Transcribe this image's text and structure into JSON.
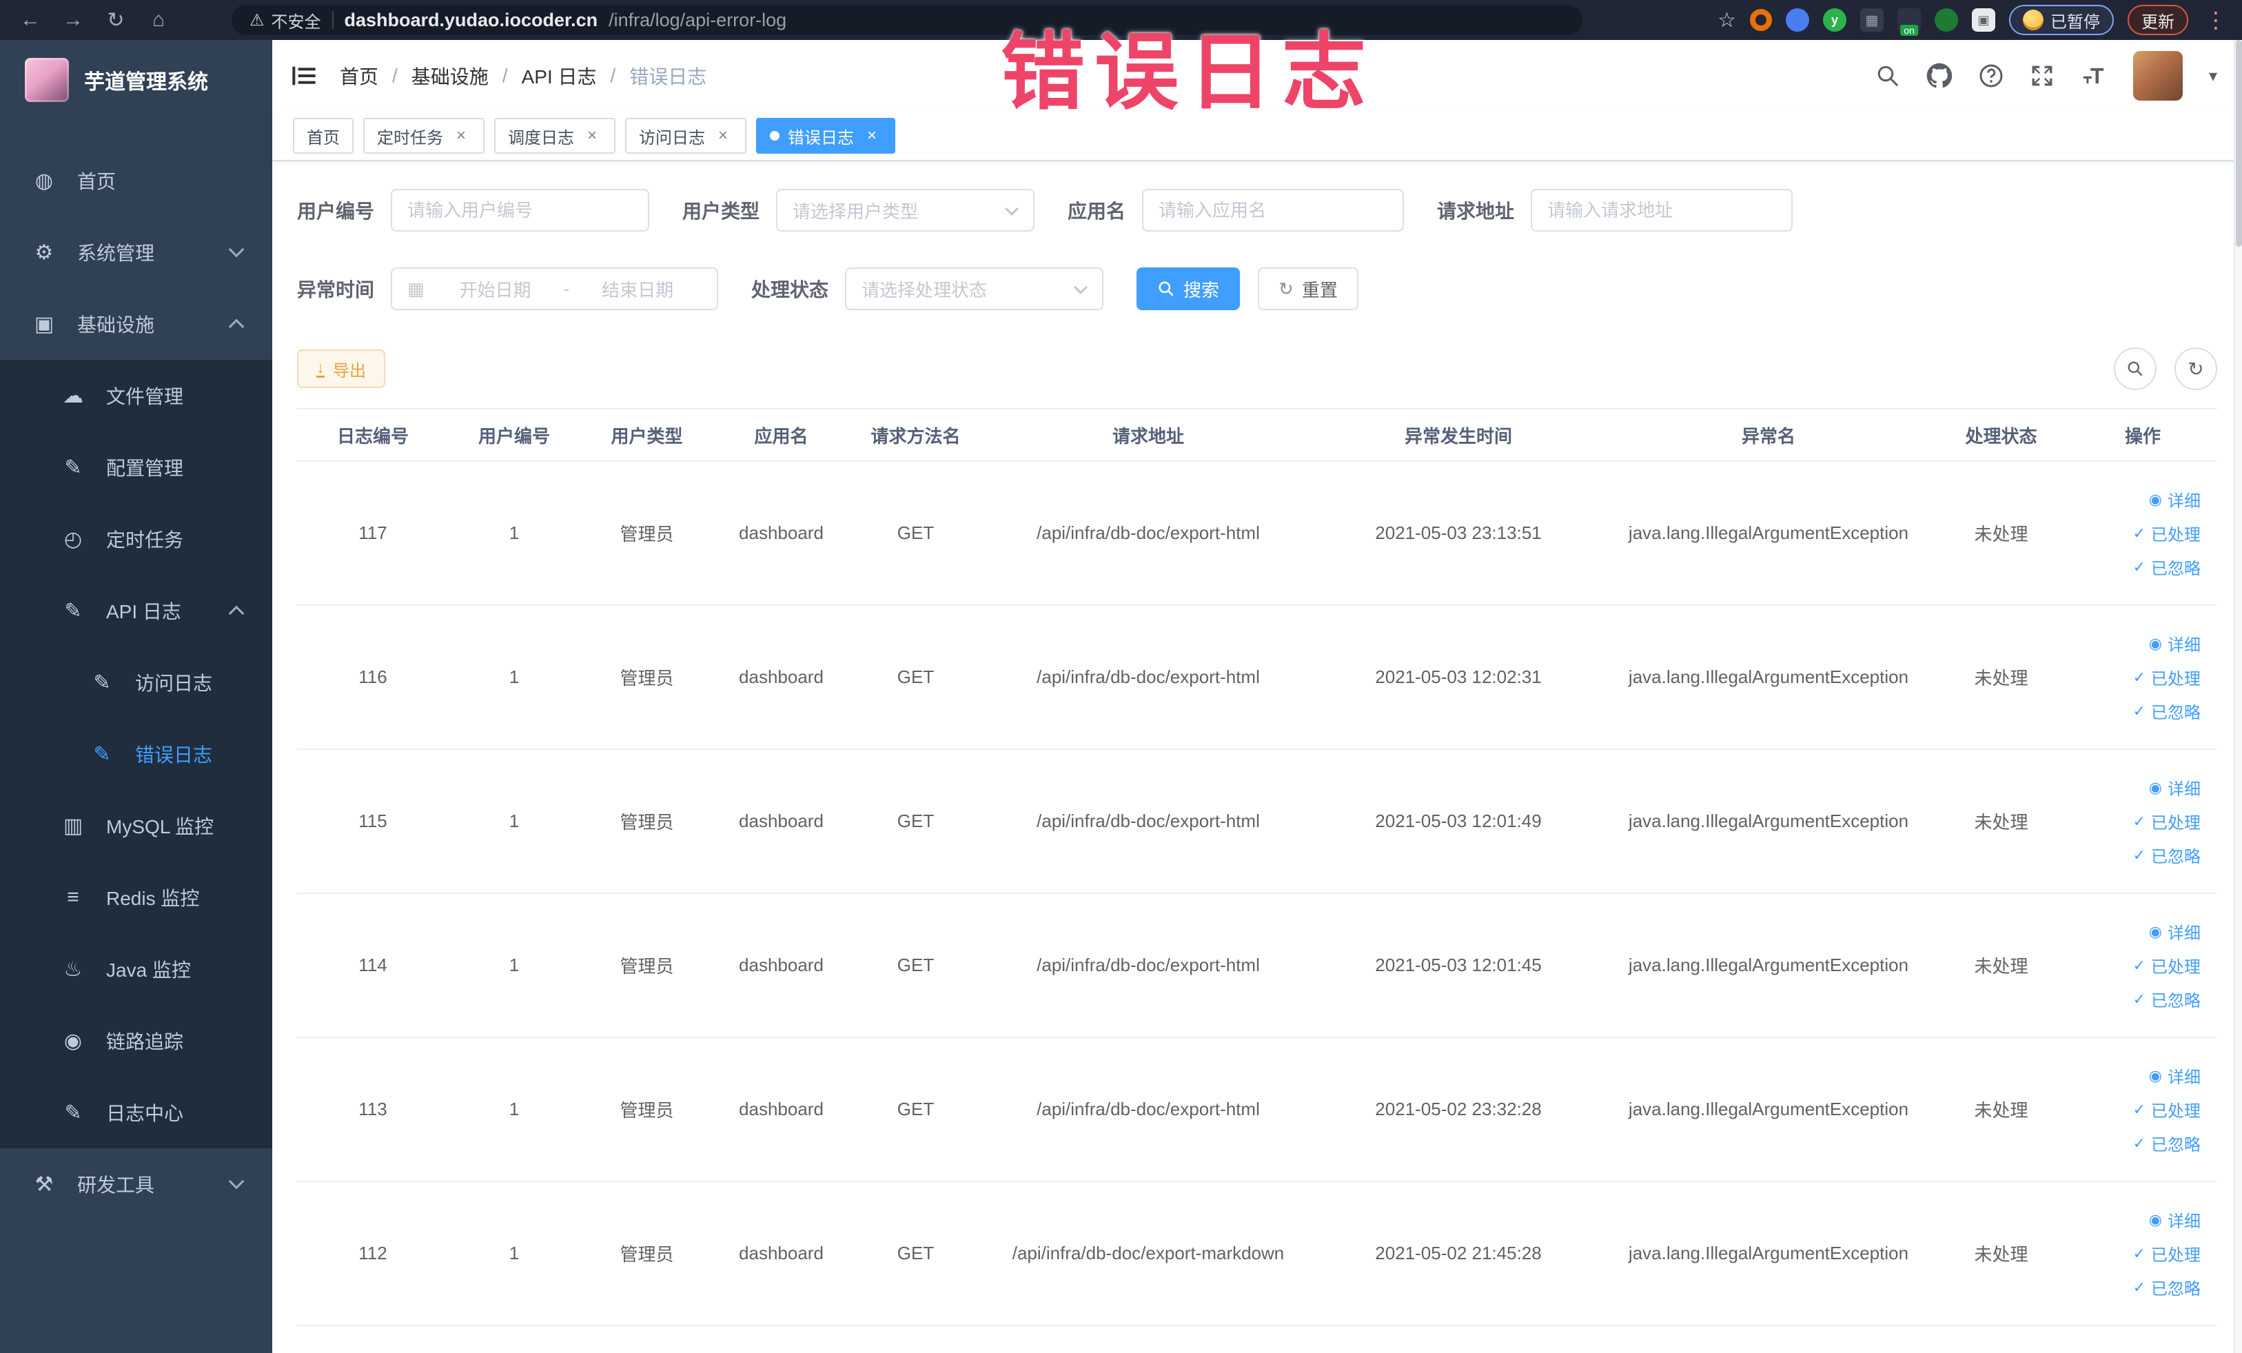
{
  "browser": {
    "security_label": "不安全",
    "url_host": "dashboard.yudao.iocoder.cn",
    "url_path": "/infra/log/api-error-log",
    "paused_label": "已暂停",
    "update_label": "更新"
  },
  "annotation": {
    "text": "错误日志",
    "color": "#ee4468"
  },
  "sidebar": {
    "logo_title": "芋道管理系统",
    "items": [
      {
        "label": "首页",
        "glyph": "◍"
      },
      {
        "label": "系统管理",
        "glyph": "⚙"
      },
      {
        "label": "基础设施",
        "glyph": "▣"
      },
      {
        "label": "文件管理",
        "glyph": "☁"
      },
      {
        "label": "配置管理",
        "glyph": "✎"
      },
      {
        "label": "定时任务",
        "glyph": "◴"
      },
      {
        "label": "API 日志",
        "glyph": "✎"
      },
      {
        "label": "访问日志",
        "glyph": "✎"
      },
      {
        "label": "错误日志",
        "glyph": "✎"
      },
      {
        "label": "MySQL 监控",
        "glyph": "▥"
      },
      {
        "label": "Redis 监控",
        "glyph": "≡"
      },
      {
        "label": "Java 监控",
        "glyph": "♨"
      },
      {
        "label": "链路追踪",
        "glyph": "◉"
      },
      {
        "label": "日志中心",
        "glyph": "✎"
      },
      {
        "label": "研发工具",
        "glyph": "⚒"
      }
    ]
  },
  "header": {
    "breadcrumb": [
      "首页",
      "基础设施",
      "API 日志",
      "错误日志"
    ],
    "separator": "/"
  },
  "tabs": [
    {
      "label": "首页"
    },
    {
      "label": "定时任务"
    },
    {
      "label": "调度日志"
    },
    {
      "label": "访问日志"
    },
    {
      "label": "错误日志"
    }
  ],
  "filters": {
    "user_id": {
      "label": "用户编号",
      "placeholder": "请输入用户编号"
    },
    "user_type": {
      "label": "用户类型",
      "placeholder": "请选择用户类型"
    },
    "app_name": {
      "label": "应用名",
      "placeholder": "请输入应用名"
    },
    "request_url": {
      "label": "请求地址",
      "placeholder": "请输入请求地址"
    },
    "exception_time": {
      "label": "异常时间",
      "start_placeholder": "开始日期",
      "end_placeholder": "结束日期",
      "separator": "-"
    },
    "process_status": {
      "label": "处理状态",
      "placeholder": "请选择处理状态"
    },
    "search_label": "搜索",
    "reset_label": "重置"
  },
  "toolbar": {
    "export_label": "导出"
  },
  "table": {
    "columns": [
      "日志编号",
      "用户编号",
      "用户类型",
      "应用名",
      "请求方法名",
      "请求地址",
      "异常发生时间",
      "异常名",
      "处理状态",
      "操作"
    ],
    "row_actions": {
      "detail": "详细",
      "processed": "已处理",
      "ignored": "已忽略"
    },
    "rows": [
      {
        "id": "117",
        "user_id": "1",
        "user_type": "管理员",
        "app": "dashboard",
        "method": "GET",
        "url": "/api/infra/db-doc/export-html",
        "time": "2021-05-03 23:13:51",
        "exception": "java.lang.IllegalArgumentException",
        "status": "未处理"
      },
      {
        "id": "116",
        "user_id": "1",
        "user_type": "管理员",
        "app": "dashboard",
        "method": "GET",
        "url": "/api/infra/db-doc/export-html",
        "time": "2021-05-03 12:02:31",
        "exception": "java.lang.IllegalArgumentException",
        "status": "未处理"
      },
      {
        "id": "115",
        "user_id": "1",
        "user_type": "管理员",
        "app": "dashboard",
        "method": "GET",
        "url": "/api/infra/db-doc/export-html",
        "time": "2021-05-03 12:01:49",
        "exception": "java.lang.IllegalArgumentException",
        "status": "未处理"
      },
      {
        "id": "114",
        "user_id": "1",
        "user_type": "管理员",
        "app": "dashboard",
        "method": "GET",
        "url": "/api/infra/db-doc/export-html",
        "time": "2021-05-03 12:01:45",
        "exception": "java.lang.IllegalArgumentException",
        "status": "未处理"
      },
      {
        "id": "113",
        "user_id": "1",
        "user_type": "管理员",
        "app": "dashboard",
        "method": "GET",
        "url": "/api/infra/db-doc/export-html",
        "time": "2021-05-02 23:32:28",
        "exception": "java.lang.IllegalArgumentException",
        "status": "未处理"
      },
      {
        "id": "112",
        "user_id": "1",
        "user_type": "管理员",
        "app": "dashboard",
        "method": "GET",
        "url": "/api/infra/db-doc/export-markdown",
        "time": "2021-05-02 21:45:28",
        "exception": "java.lang.IllegalArgumentException",
        "status": "未处理"
      }
    ]
  },
  "icons": {
    "back": "←",
    "forward": "→",
    "reload": "↻",
    "home": "⌂",
    "warning": "⚠",
    "star": "☆",
    "kebab": "⋮",
    "close": "×",
    "download": "↓",
    "refresh": "↻",
    "calendar": "▦",
    "eye": "◉",
    "check": "✓",
    "caret": "▾",
    "grid": "▦",
    "ext_y": "y",
    "on_badge": "on"
  },
  "colors": {
    "accent": "#409eff",
    "warning": "#e6a23c",
    "annotation": "#ee4468",
    "sidebar_bg": "#304156",
    "submenu_bg": "#1f2d3d"
  }
}
